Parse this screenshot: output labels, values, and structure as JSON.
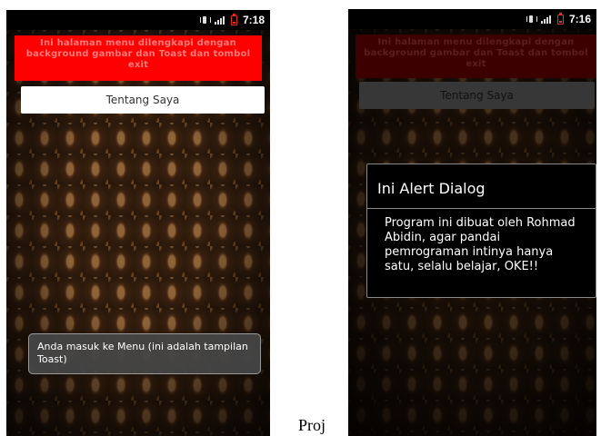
{
  "left_screen": {
    "status_time": "7:18",
    "header_text": "Ini halaman menu dilengkapi dengan background gambar dan Toast dan tombol exit",
    "button_label": "Tentang Saya",
    "toast_text": "Anda masuk ke Menu (ini adalah tampilan Toast)"
  },
  "right_screen": {
    "status_time": "7:16",
    "header_text": "Ini halaman menu dilengkapi dengan background gambar dan Toast dan tombol exit",
    "button_label": "Tentang Saya",
    "dialog": {
      "title": "Ini Alert Dialog",
      "message": "Program ini dibuat oleh Rohmad Abidin, agar pandai pemrograman intinya hanya satu, selalu belajar, OKE!!"
    }
  },
  "caption": "Proj",
  "colors": {
    "header_red": "#ff0000",
    "button_white": "#ffffff",
    "toast_gray": "#464646"
  },
  "icons": [
    "vibrate-icon",
    "signal-icon",
    "battery-icon"
  ]
}
